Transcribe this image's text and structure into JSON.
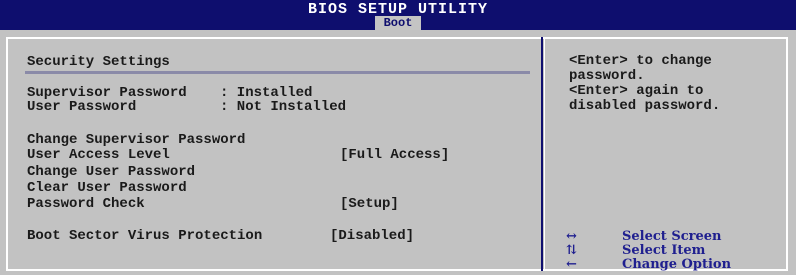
{
  "header": {
    "title": "BIOS SETUP UTILITY",
    "active_tab": "Boot"
  },
  "panel": {
    "heading": "Security Settings",
    "status": [
      {
        "label": "Supervisor Password",
        "value": ": Installed"
      },
      {
        "label": "User Password",
        "value": ": Not Installed"
      }
    ],
    "options": [
      {
        "label": "Change Supervisor Password",
        "value": ""
      },
      {
        "label": "User Access Level",
        "value": "[Full Access]"
      },
      {
        "label": "Change User Password",
        "value": ""
      },
      {
        "label": "Clear User Password",
        "value": ""
      },
      {
        "label": "Password Check",
        "value": "[Setup]"
      }
    ],
    "extra": {
      "label": "Boot Sector Virus Protection",
      "value": "[Disabled]"
    }
  },
  "help": {
    "lines": [
      "<Enter> to change",
      "password.",
      "<Enter> again to",
      "disabled password."
    ]
  },
  "keys": [
    {
      "icon": "left-right-arrows-icon",
      "glyph": "↔",
      "action": "Select Screen"
    },
    {
      "icon": "up-down-arrows-icon",
      "glyph": "⇅",
      "action": "Select Item"
    },
    {
      "icon": "left-arrow-icon",
      "glyph": "←",
      "action": "Change Option"
    }
  ],
  "colors": {
    "background": "#c2c2c2",
    "title_bar": "#0e0e6e",
    "text": "#1a1a1a",
    "key_text": "#1f1f8f"
  }
}
